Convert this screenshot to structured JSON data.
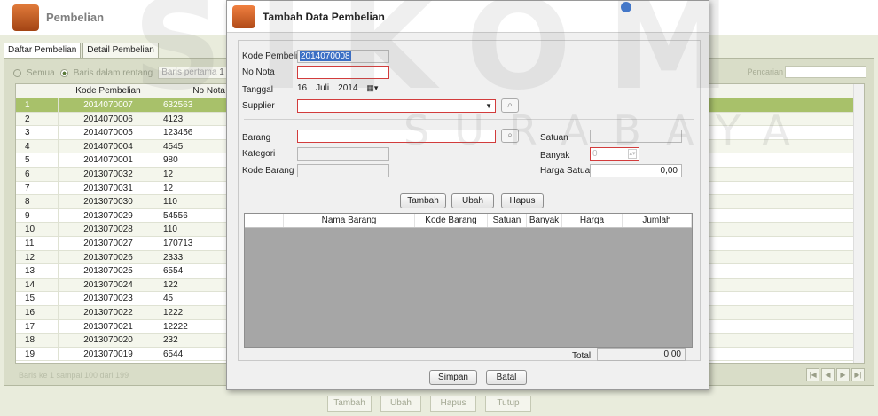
{
  "app": {
    "title": "Pembelian"
  },
  "tabs": [
    "Daftar Pembelian",
    "Detail Pembelian"
  ],
  "filter": {
    "all_label": "Semua",
    "range_label": "Baris dalam rentang",
    "first_label": "Baris pertama",
    "first_value": "1",
    "search_label": "Pencarian"
  },
  "grid": {
    "col_kode": "Kode Pembelian",
    "col_nota": "No Nota",
    "rows": [
      {
        "idx": "1",
        "kode": "2014070007",
        "nota": "632563"
      },
      {
        "idx": "2",
        "kode": "2014070006",
        "nota": "4123"
      },
      {
        "idx": "3",
        "kode": "2014070005",
        "nota": "123456"
      },
      {
        "idx": "4",
        "kode": "2014070004",
        "nota": "4545"
      },
      {
        "idx": "5",
        "kode": "2014070001",
        "nota": "980"
      },
      {
        "idx": "6",
        "kode": "2013070032",
        "nota": "12"
      },
      {
        "idx": "7",
        "kode": "2013070031",
        "nota": "12"
      },
      {
        "idx": "8",
        "kode": "2013070030",
        "nota": "110"
      },
      {
        "idx": "9",
        "kode": "2013070029",
        "nota": "54556"
      },
      {
        "idx": "10",
        "kode": "2013070028",
        "nota": "110"
      },
      {
        "idx": "11",
        "kode": "2013070027",
        "nota": "170713"
      },
      {
        "idx": "12",
        "kode": "2013070026",
        "nota": "2333"
      },
      {
        "idx": "13",
        "kode": "2013070025",
        "nota": "6554"
      },
      {
        "idx": "14",
        "kode": "2013070024",
        "nota": "122"
      },
      {
        "idx": "15",
        "kode": "2013070023",
        "nota": "45"
      },
      {
        "idx": "16",
        "kode": "2013070022",
        "nota": "1222"
      },
      {
        "idx": "17",
        "kode": "2013070021",
        "nota": "12222"
      },
      {
        "idx": "18",
        "kode": "2013070020",
        "nota": "232"
      },
      {
        "idx": "19",
        "kode": "2013070019",
        "nota": "6544"
      }
    ],
    "status": "Baris ke 1 sampai 100 dari 199"
  },
  "bottom_buttons": [
    "Tambah",
    "Ubah",
    "Hapus",
    "Tutup"
  ],
  "dialog": {
    "title": "Tambah Data Pembelian",
    "kode_label": "Kode Pembelian",
    "kode_value": "2014070008",
    "nota_label": "No Nota",
    "nota_value": "",
    "tanggal_label": "Tanggal",
    "tanggal_day": "16",
    "tanggal_month": "Juli",
    "tanggal_year": "2014",
    "supplier_label": "Supplier",
    "barang_label": "Barang",
    "kategori_label": "Kategori",
    "kodebarang_label": "Kode Barang",
    "satuan_label": "Satuan",
    "banyak_label": "Banyak",
    "banyak_value": "0",
    "harga_label": "Harga Satuan",
    "harga_value": "0,00",
    "btn_tambah": "Tambah",
    "btn_ubah": "Ubah",
    "btn_hapus": "Hapus",
    "table_cols": [
      "Nama Barang",
      "Kode Barang",
      "Satuan",
      "Banyak",
      "Harga",
      "Jumlah"
    ],
    "total_label": "Total",
    "total_value": "0,00",
    "btn_simpan": "Simpan",
    "btn_batal": "Batal"
  },
  "watermark": {
    "main": "SIKOM",
    "sub": "SURABAYA"
  }
}
